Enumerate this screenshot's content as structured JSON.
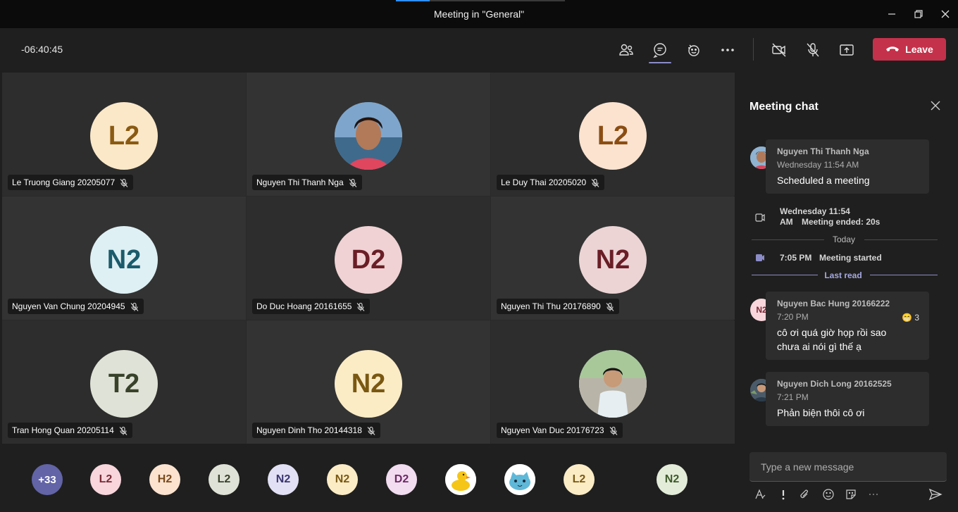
{
  "window": {
    "title": "Meeting in \"General\""
  },
  "toolbar": {
    "timer": "-06:40:45",
    "leave_label": "Leave"
  },
  "participants": [
    {
      "name": "Le Truong Giang 20205077",
      "initials": "L2",
      "bg": "#fbe8c8",
      "fg": "#8a5a12"
    },
    {
      "name": "Nguyen Thi Thanh Nga",
      "initials": "",
      "photo": true,
      "bg": "#6b8fb0"
    },
    {
      "name": "Le Duy Thai 20205020",
      "initials": "L2",
      "bg": "#fbe3d0",
      "fg": "#8a4d12"
    },
    {
      "name": "Nguyen Van Chung 20204945",
      "initials": "N2",
      "bg": "#def0f4",
      "fg": "#1b5b6b"
    },
    {
      "name": "Do Duc Hoang 20161655",
      "initials": "D2",
      "bg": "#f0d2d4",
      "fg": "#6a1e26"
    },
    {
      "name": "Nguyen Thi Thu 20176890",
      "initials": "N2",
      "bg": "#ecd4d5",
      "fg": "#6a1e26"
    },
    {
      "name": "Tran Hong Quan 20205114",
      "initials": "T2",
      "bg": "#dfe2d6",
      "fg": "#38412a"
    },
    {
      "name": "Nguyen Dinh Tho 20144318",
      "initials": "N2",
      "bg": "#fbecc6",
      "fg": "#7a5812"
    },
    {
      "name": "Nguyen Van Duc 20176723",
      "initials": "",
      "photo": true,
      "bg": "#a9c7a0"
    }
  ],
  "overflow": {
    "count_label": "+33",
    "avatars": [
      {
        "initials": "L2",
        "bg": "#f8d6dc",
        "fg": "#7a2a36"
      },
      {
        "initials": "H2",
        "bg": "#fbe3d0",
        "fg": "#7a4a1a"
      },
      {
        "initials": "L2",
        "bg": "#dfe2d6",
        "fg": "#38412a"
      },
      {
        "initials": "N2",
        "bg": "#e2e0f4",
        "fg": "#3a3570"
      },
      {
        "initials": "N2",
        "bg": "#fbecc6",
        "fg": "#7a5812"
      },
      {
        "initials": "D2",
        "bg": "#f2dcf0",
        "fg": "#6a2a64"
      },
      {
        "initials": "",
        "image": "duck",
        "bg": "#ffffff"
      },
      {
        "initials": "",
        "image": "cat",
        "bg": "#ffffff"
      },
      {
        "initials": "L2",
        "bg": "#fbecc6",
        "fg": "#7a5812"
      },
      {
        "initials": "N2",
        "bg": "#e3ecd9",
        "fg": "#3d5a2a"
      }
    ]
  },
  "chat": {
    "title": "Meeting chat",
    "messages": [
      {
        "author": "Nguyen Thi Thanh Nga",
        "time": "Wednesday 11:54 AM",
        "text": "Scheduled a meeting"
      },
      {
        "author": "Nguyen Bac Hung 20166222",
        "time": "7:20 PM",
        "text": "cô ơi quá giờ họp rồi sao chưa ai nói gì thế ạ",
        "initials": "N2",
        "reaction": "😁",
        "reaction_count": "3"
      },
      {
        "author": "Nguyen Dich Long 20162525",
        "time": "7:21 PM",
        "text": "Phản biện thôi cô ơi"
      }
    ],
    "system": {
      "ended_time_line1": "Wednesday 11:54",
      "ended_time_line2": "AM",
      "ended_text": "Meeting ended: 20s",
      "today_label": "Today",
      "started_time": "7:05 PM",
      "started_text": "Meeting started",
      "last_read_label": "Last read"
    },
    "compose_placeholder": "Type a new message"
  },
  "colors": {
    "accent": "#8b8cc7",
    "leave": "#c4314b",
    "overflow_badge": "#6264a7"
  }
}
